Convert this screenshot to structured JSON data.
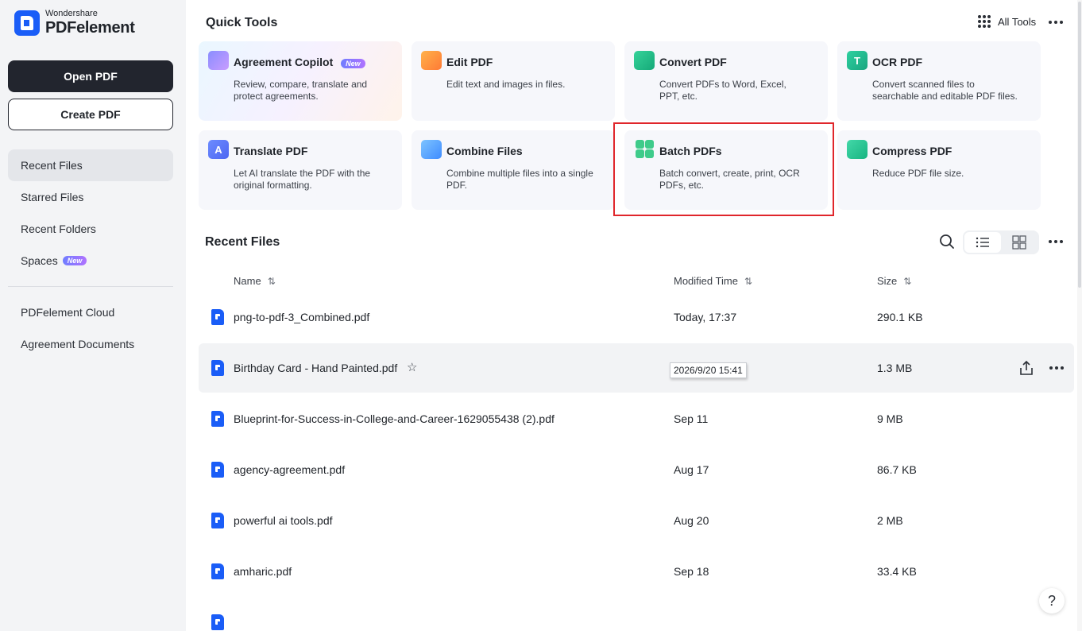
{
  "app": {
    "brand": "Wondershare",
    "product": "PDFelement"
  },
  "sidebar": {
    "open_label": "Open PDF",
    "create_label": "Create PDF",
    "items": [
      {
        "label": "Recent Files"
      },
      {
        "label": "Starred Files"
      },
      {
        "label": "Recent Folders"
      },
      {
        "label": "Spaces",
        "badge": "New"
      },
      {
        "label": "PDFelement Cloud"
      },
      {
        "label": "Agreement Documents"
      }
    ]
  },
  "quick_tools": {
    "title": "Quick Tools",
    "all_tools_label": "All Tools",
    "tools": [
      {
        "title": "Agreement Copilot",
        "badge": "New",
        "desc": "Review, compare, translate and protect agreements.",
        "icon": "agreement-copilot-icon"
      },
      {
        "title": "Edit PDF",
        "desc": "Edit text and images in files.",
        "icon": "edit-pdf-icon"
      },
      {
        "title": "Convert PDF",
        "desc": "Convert PDFs to Word, Excel, PPT, etc.",
        "icon": "convert-pdf-icon"
      },
      {
        "title": "OCR PDF",
        "desc": "Convert scanned files to searchable and editable PDF files.",
        "icon": "ocr-pdf-icon"
      },
      {
        "title": "Translate PDF",
        "desc": "Let AI translate the PDF with the original formatting.",
        "icon": "translate-pdf-icon"
      },
      {
        "title": "Combine Files",
        "desc": "Combine multiple files into a single PDF.",
        "icon": "combine-files-icon"
      },
      {
        "title": "Batch PDFs",
        "desc": "Batch convert, create, print, OCR PDFs, etc.",
        "icon": "batch-pdfs-icon"
      },
      {
        "title": "Compress PDF",
        "desc": "Reduce PDF file size.",
        "icon": "compress-pdf-icon"
      }
    ]
  },
  "recent": {
    "title": "Recent Files",
    "columns": {
      "name": "Name",
      "modified": "Modified Time",
      "size": "Size"
    },
    "tooltip": "2026/9/20 15:41",
    "files": [
      {
        "name": "png-to-pdf-3_Combined.pdf",
        "modified": "Today, 17:37",
        "size": "290.1 KB"
      },
      {
        "name": "Birthday Card - Hand Painted.pdf",
        "modified": "",
        "size": "1.3 MB"
      },
      {
        "name": "Blueprint-for-Success-in-College-and-Career-1629055438 (2).pdf",
        "modified": "Sep 11",
        "size": "9 MB"
      },
      {
        "name": "agency-agreement.pdf",
        "modified": "Aug 17",
        "size": "86.7 KB"
      },
      {
        "name": "powerful ai tools.pdf",
        "modified": "Aug 20",
        "size": "2 MB"
      },
      {
        "name": "amharic.pdf",
        "modified": "Sep 18",
        "size": "33.4 KB"
      }
    ]
  },
  "help_label": "?",
  "colors": {
    "accent": "#1a5df7",
    "highlight": "#e0262b",
    "primary_button": "#22252e"
  }
}
